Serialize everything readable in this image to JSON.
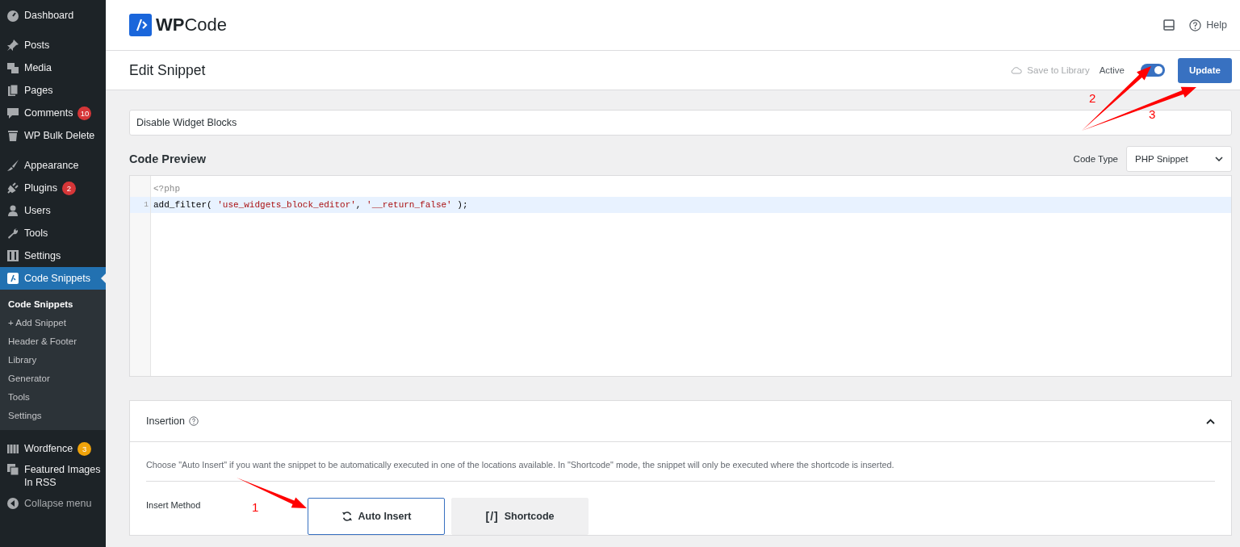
{
  "sidebar": {
    "groups": [
      [
        {
          "label": "Dashboard",
          "selected": false
        }
      ],
      [
        {
          "label": "Posts",
          "selected": false
        },
        {
          "label": "Media",
          "selected": false
        },
        {
          "label": "Pages",
          "selected": false
        },
        {
          "label": "Comments",
          "selected": false,
          "badge": {
            "text": "10",
            "color": "#d63638"
          }
        },
        {
          "label": "WP Bulk Delete",
          "selected": false
        }
      ],
      [
        {
          "label": "Appearance",
          "selected": false
        },
        {
          "label": "Plugins",
          "selected": false,
          "badge": {
            "text": "2",
            "color": "#d63638"
          }
        },
        {
          "label": "Users",
          "selected": false
        },
        {
          "label": "Tools",
          "selected": false
        },
        {
          "label": "Settings",
          "selected": false
        },
        {
          "label": "Code Snippets",
          "selected": true,
          "children": [
            {
              "label": "Code Snippets",
              "selected": true
            },
            {
              "label": "+ Add Snippet",
              "selected": false
            },
            {
              "label": "Header & Footer",
              "selected": false
            },
            {
              "label": "Library",
              "selected": false
            },
            {
              "label": "Generator",
              "selected": false
            },
            {
              "label": "Tools",
              "selected": false
            },
            {
              "label": "Settings",
              "selected": false
            }
          ]
        }
      ],
      [
        {
          "label": "Wordfence",
          "selected": false,
          "badge": {
            "text": "3",
            "color": "#f0a30a"
          }
        },
        {
          "label": "Featured Images In RSS",
          "selected": false
        },
        {
          "label": "Collapse menu",
          "selected": false
        }
      ]
    ]
  },
  "header": {
    "logo_bold": "WP",
    "logo_rest": "Code",
    "help": "Help"
  },
  "toolbar": {
    "title": "Edit Snippet",
    "save_to_library": "Save to Library",
    "active_label": "Active",
    "active": true,
    "update": "Update"
  },
  "snippet_title": {
    "value": "Disable Widget Blocks"
  },
  "code_preview": {
    "heading": "Code Preview",
    "code_type_label": "Code Type",
    "code_type": "PHP Snippet",
    "lines": [
      {
        "highlighted": false,
        "tokens": [
          {
            "kind": "meta",
            "text": "<?php"
          }
        ]
      },
      {
        "number": "1",
        "highlighted": true,
        "tokens": [
          {
            "kind": "plain",
            "text": "add_filter( "
          },
          {
            "kind": "string",
            "text": "'use_widgets_block_editor'"
          },
          {
            "kind": "plain",
            "text": ", "
          },
          {
            "kind": "string",
            "text": "'__return_false'"
          },
          {
            "kind": "plain",
            "text": " );"
          }
        ]
      }
    ]
  },
  "insertion": {
    "heading": "Insertion",
    "expanded": true,
    "description": "Choose \"Auto Insert\" if you want the snippet to be automatically executed in one of the locations available. In \"Shortcode\" mode, the snippet will only be executed where the shortcode is inserted.",
    "method_label": "Insert Method",
    "methods": [
      {
        "kind": "auto",
        "label": "Auto Insert",
        "selected": true
      },
      {
        "kind": "shortcode",
        "icon_text": "[/]",
        "label": "Shortcode",
        "selected": false
      }
    ]
  },
  "annotations": [
    {
      "label": "1"
    },
    {
      "label": "2"
    },
    {
      "label": "3"
    }
  ]
}
